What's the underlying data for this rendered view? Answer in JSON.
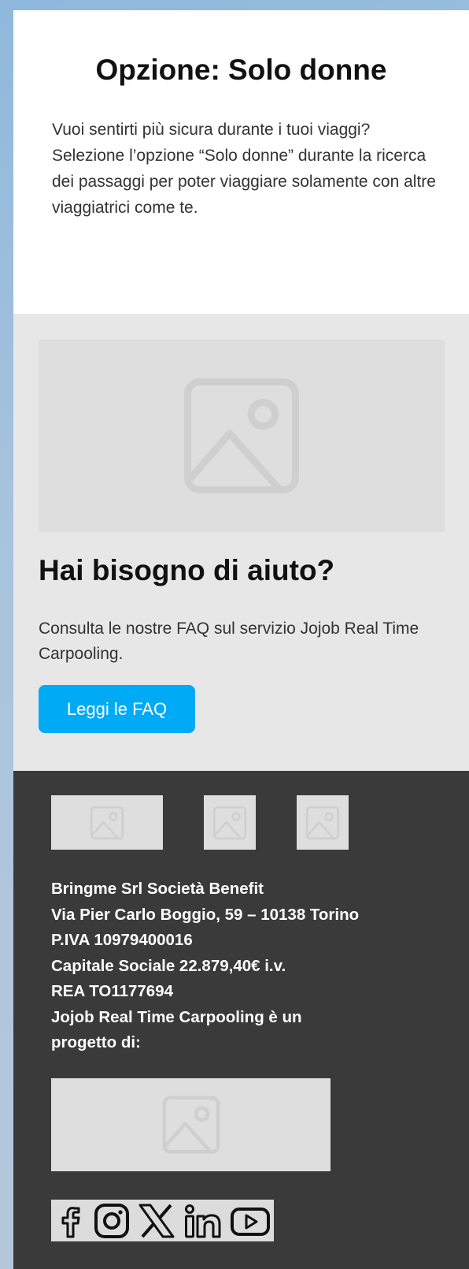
{
  "intro": {
    "title": "Opzione: Solo donne",
    "body": "Vuoi sentirti più sicura durante i tuoi viaggi? Selezione l’opzione “Solo donne” durante la ricerca dei passaggi per poter viaggiare solamente con altre viaggiatrici come te."
  },
  "help": {
    "image_icon": "image-placeholder-icon",
    "title": "Hai bisogno di aiuto?",
    "body": "Consulta le nostre FAQ sul servizio Jojob Real Time Carpooling.",
    "button_label": "Leggi le FAQ",
    "button_color": "#00aaf5"
  },
  "footer": {
    "background": "#3a3a3a",
    "company_lines": [
      "Bringme Srl Società Benefit",
      "Via Pier Carlo Boggio, 59 – 10138 Torino",
      "P.IVA 10979400016",
      "Capitale Sociale 22.879,40€ i.v.",
      "REA TO1177694",
      "Jojob Real Time Carpooling è un",
      "progetto di:"
    ],
    "social_icons": [
      "facebook-icon",
      "instagram-icon",
      "x-icon",
      "linkedin-icon",
      "youtube-icon"
    ]
  }
}
